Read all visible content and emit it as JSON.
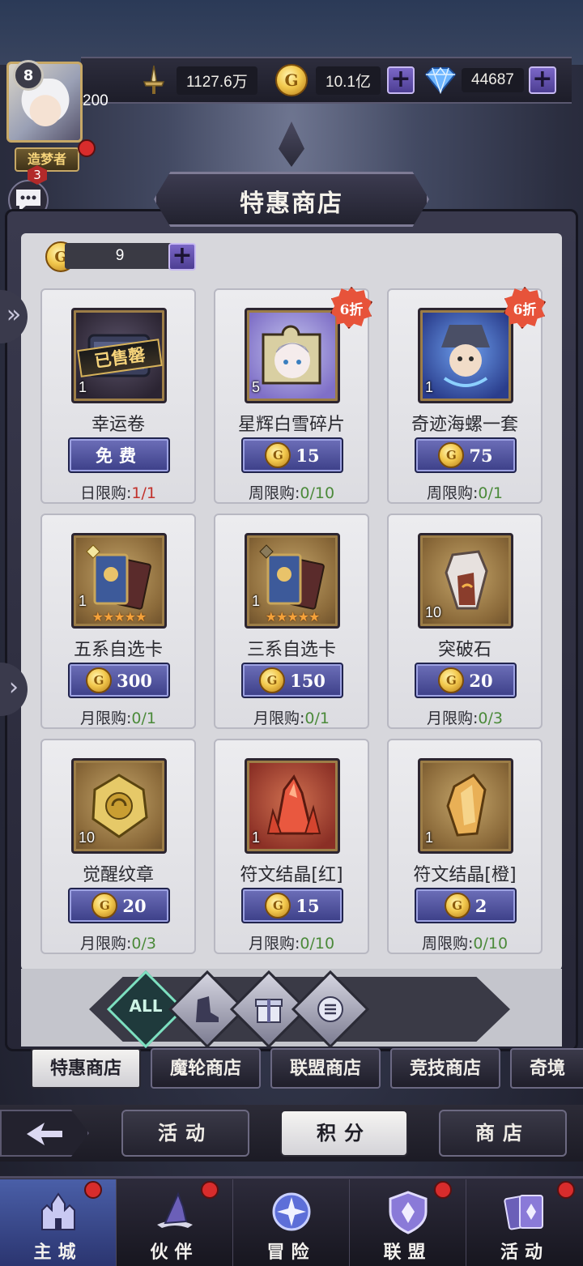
{
  "header": {
    "level": "8",
    "power": "200",
    "title_badge": "造梦者",
    "chat_count": "3",
    "chat_label": "聊天",
    "combat_power": "1127.6万",
    "gold": "10.1亿",
    "gems": "44687"
  },
  "shop": {
    "title": "特惠商店",
    "token_count": "9",
    "items": [
      {
        "name": "幸运卷",
        "qty": "1",
        "price": "免费",
        "limit_label": "日限购:",
        "limit": "1/1",
        "sold_out": "已售罄",
        "discount": ""
      },
      {
        "name": "星辉白雪碎片",
        "qty": "5",
        "price": "15",
        "limit_label": "周限购:",
        "limit": "0/10",
        "discount": "6折"
      },
      {
        "name": "奇迹海螺一套",
        "qty": "1",
        "price": "75",
        "limit_label": "周限购:",
        "limit": "0/1",
        "discount": "6折"
      },
      {
        "name": "五系自选卡",
        "qty": "1",
        "price": "300",
        "limit_label": "月限购:",
        "limit": "0/1",
        "stars": "★★★★★"
      },
      {
        "name": "三系自选卡",
        "qty": "1",
        "price": "150",
        "limit_label": "月限购:",
        "limit": "0/1",
        "stars": "★★★★★"
      },
      {
        "name": "突破石",
        "qty": "10",
        "price": "20",
        "limit_label": "月限购:",
        "limit": "0/3"
      },
      {
        "name": "觉醒纹章",
        "qty": "10",
        "price": "20",
        "limit_label": "月限购:",
        "limit": "0/3"
      },
      {
        "name": "符文结晶[红]",
        "qty": "1",
        "price": "15",
        "limit_label": "月限购:",
        "limit": "0/10"
      },
      {
        "name": "符文结晶[橙]",
        "qty": "1",
        "price": "2",
        "limit_label": "周限购:",
        "limit": "0/10"
      }
    ],
    "filters": {
      "all": "ALL"
    }
  },
  "shop_tabs": [
    "特惠商店",
    "魔轮商店",
    "联盟商店",
    "竞技商店",
    "奇境"
  ],
  "subnav": [
    "活动",
    "积分",
    "商店"
  ],
  "bottom_nav": [
    "主城",
    "伙伴",
    "冒险",
    "联盟",
    "活动"
  ],
  "colors": {
    "accent_purple": "#4d3e93",
    "limit_green": "#4b8a3a",
    "limit_red": "#c2312b",
    "discount_red": "#e7533a",
    "nav_active": "#4a5fa8"
  }
}
